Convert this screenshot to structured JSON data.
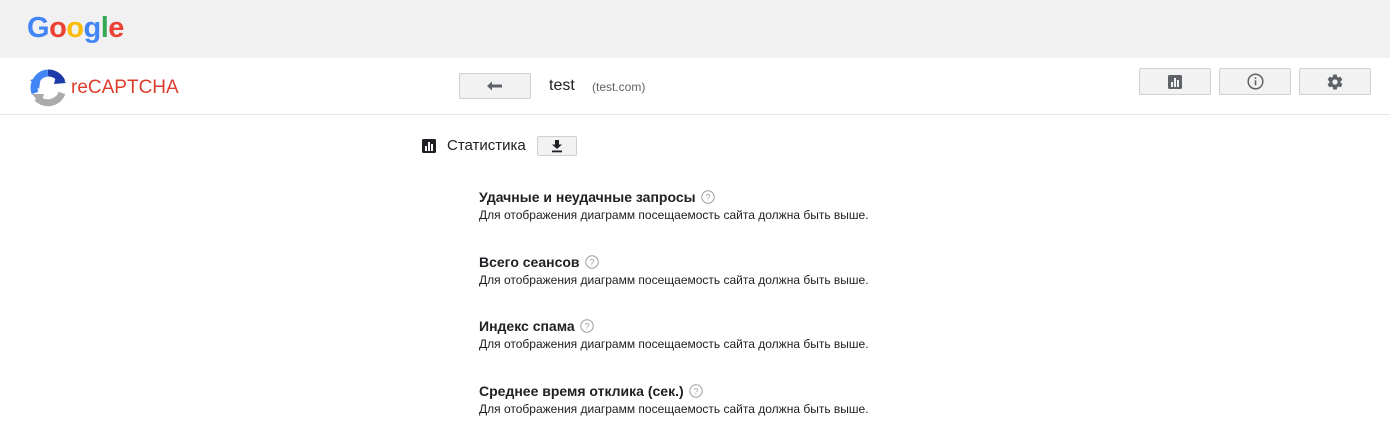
{
  "header": {
    "google_logo_letters": [
      {
        "ch": "G",
        "color": "#4285F4"
      },
      {
        "ch": "o",
        "color": "#EA4335"
      },
      {
        "ch": "o",
        "color": "#FBBC05"
      },
      {
        "ch": "g",
        "color": "#4285F4"
      },
      {
        "ch": "l",
        "color": "#34A853"
      },
      {
        "ch": "e",
        "color": "#EA4335"
      }
    ]
  },
  "app_bar": {
    "product_name": "reCAPTCHA",
    "product_color": "#dc3d2b",
    "site_name": "test",
    "site_domain": "(test.com)",
    "icons": {
      "back": "arrow-back-icon",
      "stats": "bar-chart-icon",
      "info": "info-icon",
      "settings": "gear-icon"
    }
  },
  "stats": {
    "section_title": "Статистика",
    "items": [
      {
        "title": "Удачные и неудачные запросы",
        "description": "Для отображения диаграмм посещаемость сайта должна быть выше."
      },
      {
        "title": "Всего сеансов",
        "description": "Для отображения диаграмм посещаемость сайта должна быть выше."
      },
      {
        "title": "Индекс спама",
        "description": "Для отображения диаграмм посещаемость сайта должна быть выше."
      },
      {
        "title": "Среднее время отклика (сек.)",
        "description": "Для отображения диаграмм посещаемость сайта должна быть выше."
      }
    ]
  }
}
